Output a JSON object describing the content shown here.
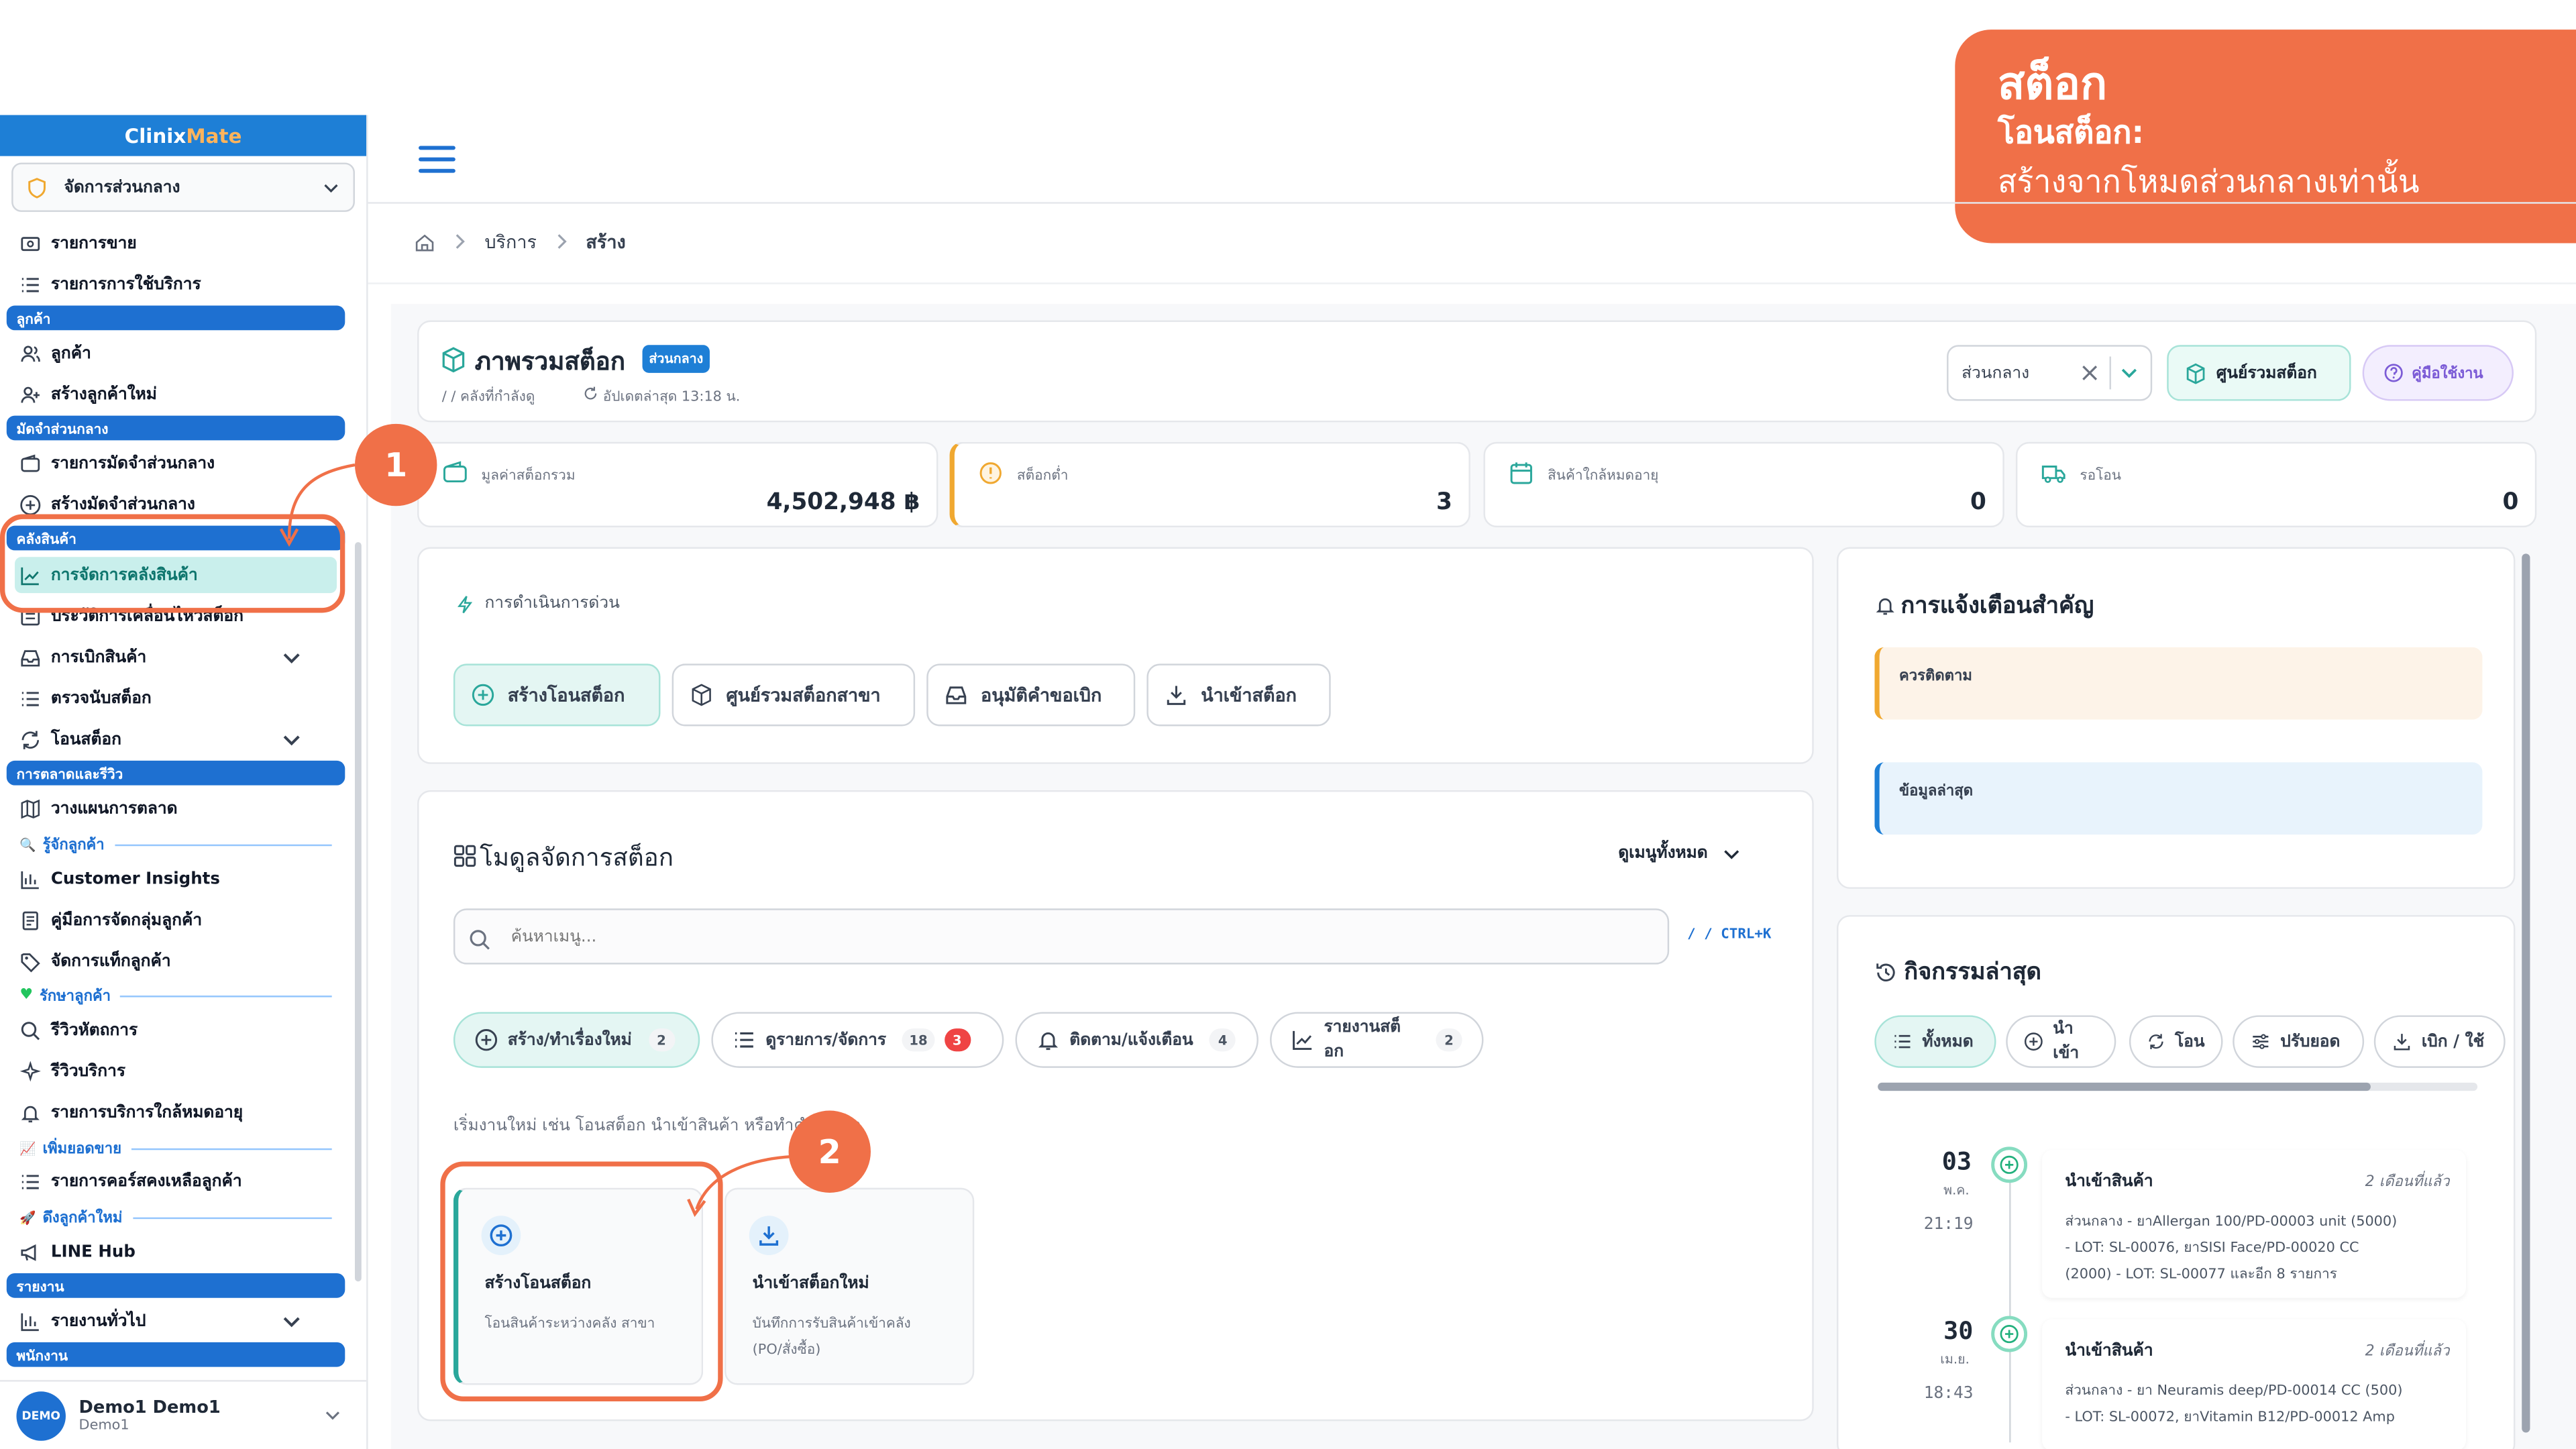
{
  "banner": {
    "title": "สต็อก",
    "subtitle": "โอนสต็อก:",
    "note": "สร้างจากโหมดส่วนกลางเท่านั้น"
  },
  "sidebar": {
    "brand_part1": "Clinix",
    "brand_part2": "Mate",
    "selector": "จัดการส่วนกลาง",
    "items": {
      "sales": "รายการขาย",
      "service_list": "รายการการใช้บริการ",
      "sec_customer": "ลูกค้า",
      "customer": "ลูกค้า",
      "new_customer": "สร้างลูกค้าใหม่",
      "sec_deposit": "มัดจำส่วนกลาง",
      "deposit_list": "รายการมัดจำส่วนกลาง",
      "create_deposit": "สร้างมัดจำส่วนกลาง",
      "sec_warehouse": "คลังสินค้า",
      "warehouse_mgmt": "การจัดการคลังสินค้า",
      "stock_history": "ประวัติการเคลื่อนไหวสต็อก",
      "withdraw": "การเบิกสินค้า",
      "stock_count": "ตรวจนับสต็อก",
      "stock_transfer": "โอนสต็อก",
      "sec_marketing": "การตลาดและรีวิว",
      "marketing_plan": "วางแผนการตลาด",
      "sub_know": "รู้จักลูกค้า",
      "customer_insights": "Customer Insights",
      "segment_guide": "คู่มือการจัดกลุ่มลูกค้า",
      "tags": "จัดการแท็กลูกค้า",
      "sub_retain": "รักษาลูกค้า",
      "review_treatment": "รีวิวหัตถการ",
      "review_service": "รีวิวบริการ",
      "near_expiry_service": "รายการบริการใกล้หมดอายุ",
      "sub_sales": "เพิ่มยอดขาย",
      "remaining_course": "รายการคอร์สคงเหลือลูกค้า",
      "sub_new": "ดึงลูกค้าใหม่",
      "line_hub": "LINE Hub",
      "sec_report": "รายงาน",
      "report_general": "รายงานทั่วไป",
      "sec_staff": "พนักงาน"
    },
    "user": {
      "avatar": "DEMO",
      "name": "Demo1 Demo1",
      "sub": "Demo1"
    }
  },
  "breadcrumb": {
    "b1": "บริการ",
    "b2": "สร้าง"
  },
  "overview": {
    "title": "ภาพรวมสต็อก",
    "badge": "ส่วนกลาง",
    "sub_path": "/ / คลังที่กำลังดู",
    "updated": "อัปเดตล่าสุด 13:18 น.",
    "select_value": "ส่วนกลาง",
    "btn_center": "ศูนย์รวมสต็อก",
    "btn_guide": "คู่มือใช้งาน"
  },
  "stats": [
    {
      "label": "มูลค่าสต็อกรวม",
      "value": "4,502,948 ฿"
    },
    {
      "label": "สต็อกต่ำ",
      "value": "3"
    },
    {
      "label": "สินค้าใกล้หมดอายุ",
      "value": "0"
    },
    {
      "label": "รอโอน",
      "value": "0"
    }
  ],
  "quick": {
    "title": "การดำเนินการด่วน",
    "b1": "สร้างโอนสต็อก",
    "b2": "ศูนย์รวมสต็อกสาขา",
    "b3": "อนุมัติคำขอเบิก",
    "b4": "นำเข้าสต็อก"
  },
  "modules": {
    "title": "โมดูลจัดการสต็อก",
    "view_all": "ดูเมนูทั้งหมด",
    "search_placeholder": "ค้นหาเมนู...",
    "shortcut": "/ / CTRL+K",
    "chips": [
      {
        "label": "สร้าง/ทำเรื่องใหม่",
        "count": "2"
      },
      {
        "label": "ดูรายการ/จัดการ",
        "count": "18",
        "count2": "3"
      },
      {
        "label": "ติดตาม/แจ้งเตือน",
        "count": "4"
      },
      {
        "label": "รายงานสต็อก",
        "count": "2"
      }
    ],
    "hint": "เริ่มงานใหม่ เช่น โอนสต็อก นำเข้าสินค้า หรือทำคำขอเบิก",
    "cards": [
      {
        "title": "สร้างโอนสต็อก",
        "desc": "โอนสินค้าระหว่างคลัง สาขา"
      },
      {
        "title": "นำเข้าสต็อกใหม่",
        "desc": "บันทึกการรับสินค้าเข้าคลัง",
        "desc2": "(PO/สั่งซื้อ)"
      }
    ]
  },
  "alerts": {
    "title": "การแจ้งเตือนสำคัญ",
    "a1": "ควรติดตาม",
    "a2": "ข้อมูลล่าสุด"
  },
  "activity": {
    "title": "กิจกรรมล่าสุด",
    "tabs": [
      "ทั้งหมด",
      "นำเข้า",
      "โอน",
      "ปรับยอด",
      "เบิก / ใช้"
    ],
    "items": [
      {
        "day": "03",
        "month": "พ.ค.",
        "time": "21:19",
        "title": "นำเข้าสินค้า",
        "ago": "2 เดือนที่แล้ว",
        "l1": "ส่วนกลาง - ยาAllergan 100/PD-00003 unit (5000)",
        "l2": "- LOT: SL-00076, ยาSISI Face/PD-00020 CC",
        "l3": "(2000) - LOT: SL-00077 และอีก 8 รายการ"
      },
      {
        "day": "30",
        "month": "เม.ย.",
        "time": "18:43",
        "title": "นำเข้าสินค้า",
        "ago": "2 เดือนที่แล้ว",
        "l1": "ส่วนกลาง - ยา Neuramis deep/PD-00014 CC (500)",
        "l2": "- LOT: SL-00072, ยาVitamin B12/PD-00012 Amp",
        "l3": ""
      }
    ]
  },
  "annotations": {
    "n1": "1",
    "n2": "2"
  },
  "colors": {
    "accent": "#f07048",
    "primary": "#1e70d1",
    "teal": "#2aa79b"
  }
}
